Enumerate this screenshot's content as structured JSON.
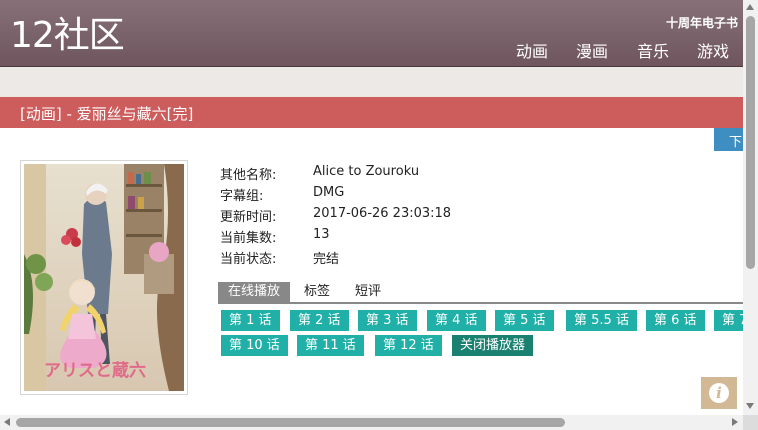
{
  "header": {
    "logo": "12社区",
    "ebook_link": "十周年电子书",
    "nav": [
      "动画",
      "漫画",
      "音乐",
      "游戏"
    ]
  },
  "page_title": "[动画] - 爱丽丝与藏六[完]",
  "download_tab": "下",
  "info": [
    {
      "label": "其他名称:",
      "value": "Alice to Zouroku"
    },
    {
      "label": "字幕组:",
      "value": "DMG"
    },
    {
      "label": "更新时间:",
      "value": "2017-06-26 23:03:18"
    },
    {
      "label": "当前集数:",
      "value": "13"
    },
    {
      "label": "当前状态:",
      "value": "完结"
    }
  ],
  "tabs": [
    "在线播放",
    "标签",
    "短评"
  ],
  "episodes_row1": [
    "第 1 话",
    "第 2 话",
    "第 3 话",
    "第 4 话",
    "第 5 话",
    "第 5.5 话",
    "第 6 话",
    "第 7"
  ],
  "episodes_row2": [
    "第 10 话",
    "第 11 话",
    "第 12 话"
  ],
  "close_player": "关闭播放器",
  "poster": {
    "title_text": "アリスと蔵六"
  },
  "info_button": "i",
  "colors": {
    "header": "#7a6168",
    "title_bar": "#cd5c5c",
    "episode": "#21b0a8",
    "close_player": "#1a8070",
    "download": "#3e8ec2"
  }
}
